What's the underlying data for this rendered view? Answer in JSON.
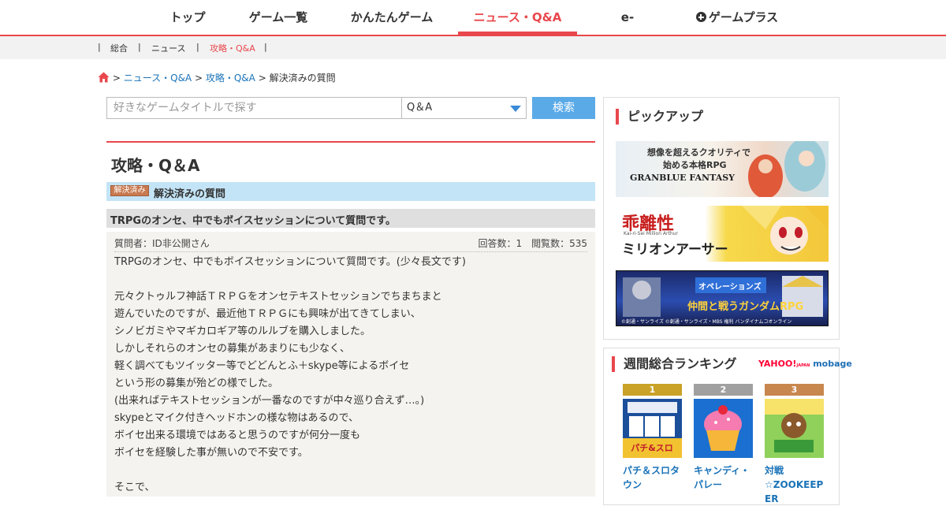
{
  "topnav": {
    "items": [
      {
        "label": "トップ"
      },
      {
        "label": "ゲーム一覧"
      },
      {
        "label": "かんたんゲーム"
      },
      {
        "label": "ニュース・Q&A",
        "active": true
      },
      {
        "label": "e-Sports"
      },
      {
        "label": "ゲームプラス"
      }
    ]
  },
  "subnav": {
    "items": [
      {
        "label": "総合"
      },
      {
        "label": "ニュース"
      },
      {
        "label": "攻略・Q&A",
        "active": true
      }
    ],
    "separator": "|"
  },
  "breadcrumb": {
    "sep": ">",
    "items": [
      "ニュース・Q&A",
      "攻略・Q&A",
      "解決済みの質問"
    ]
  },
  "search": {
    "placeholder": "好きなゲームタイトルで探す",
    "category": "Q＆A",
    "button": "検索"
  },
  "main": {
    "page_title": "攻略・Q＆A",
    "solved_badge": "解決済み",
    "solved_title": "解決済みの質問",
    "question_title": "TRPGのオンセ、中でもボイスセッションについて質問です。",
    "asker": "質問者：ID非公開さん",
    "stats": "回答数：1　閲覧数：535",
    "body": [
      "TRPGのオンセ、中でもボイスセッションについて質問です。(少々長文です)",
      "",
      "元々クトゥルフ神話ＴＲＰＧをオンセテキストセッションでちまちまと",
      "遊んでいたのですが、最近他ＴＲＰＧにも興味が出てきてしまい、",
      "シノビガミやマギカロギア等のルルブを購入しました。",
      "しかしそれらのオンセの募集があまりにも少なく、",
      "軽く調べてもツイッター等でどどんとふ＋skype等によるボイセ",
      "という形の募集が殆どの様でした。",
      "(出来ればテキストセッションが一番なのですが中々巡り合えず…。)",
      "skypeとマイク付きヘッドホンの様な物はあるので、",
      "ボイセ出来る環境ではあると思うのですが何分一度も",
      "ボイセを経験した事が無いので不安です。",
      "",
      "そこで、"
    ]
  },
  "sidebar": {
    "pickup_heading": "ピックアップ",
    "banners": [
      {
        "line1": "想像を超えるクオリティで",
        "line2": "始める本格RPG",
        "line3": "GRANBLUE FANTASY"
      },
      {
        "line1": "乖離性",
        "line2": "ミリオンアーサー",
        "line3": "Kai-ri-Sei Million Arthur"
      },
      {
        "line1": "オペレーションズ",
        "line2": "仲間と戦うガンダムRPG",
        "line3": "©創通・サンライズ ©創通・サンライズ・MBS 権利 バンダイナムコオンライン"
      }
    ],
    "ranking_heading": "週間総合ランキング",
    "yahoo": "YAHOO!",
    "yahoo_sub": "JAPAN",
    "mobage": "mobage",
    "ranking": [
      {
        "rank": "1",
        "name_lines": [
          "パチ＆スロタ",
          "ウン"
        ],
        "color": "#c9a227"
      },
      {
        "rank": "2",
        "name_lines": [
          "キャンディ・",
          "パレー"
        ],
        "color": "#a0a0a0"
      },
      {
        "rank": "3",
        "name_lines": [
          "対戦",
          "☆ZOOKEEP",
          "ER"
        ],
        "color": "#c8874e"
      }
    ]
  },
  "colors": {
    "accent": "#e8474c",
    "link": "#1a73b8",
    "button": "#5aaae8",
    "solved_bar": "#c3e4f6"
  }
}
